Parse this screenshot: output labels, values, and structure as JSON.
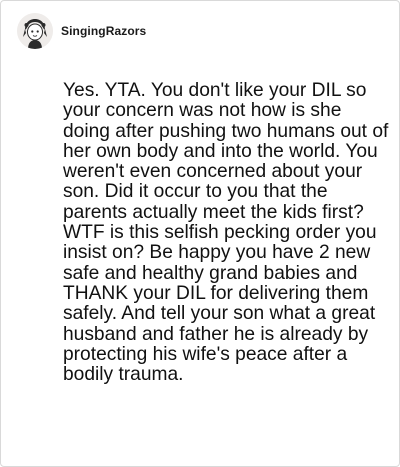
{
  "comment": {
    "username": "SingingRazors",
    "avatar_icon": "cartoon-avatar-icon",
    "body": "Yes. YTA. You don't like your DIL so your concern was not how is she doing after pushing two humans out of her own body and into the world. You weren't even concerned about your son. Did it occur to you that the parents actually meet the kids first? WTF is this selfish pecking order you insist on? Be happy you have 2 new safe and healthy grand babies and THANK your DIL for delivering them safely. And tell your son what a great husband and father he is already by protecting his wife's peace after a bodily trauma."
  }
}
